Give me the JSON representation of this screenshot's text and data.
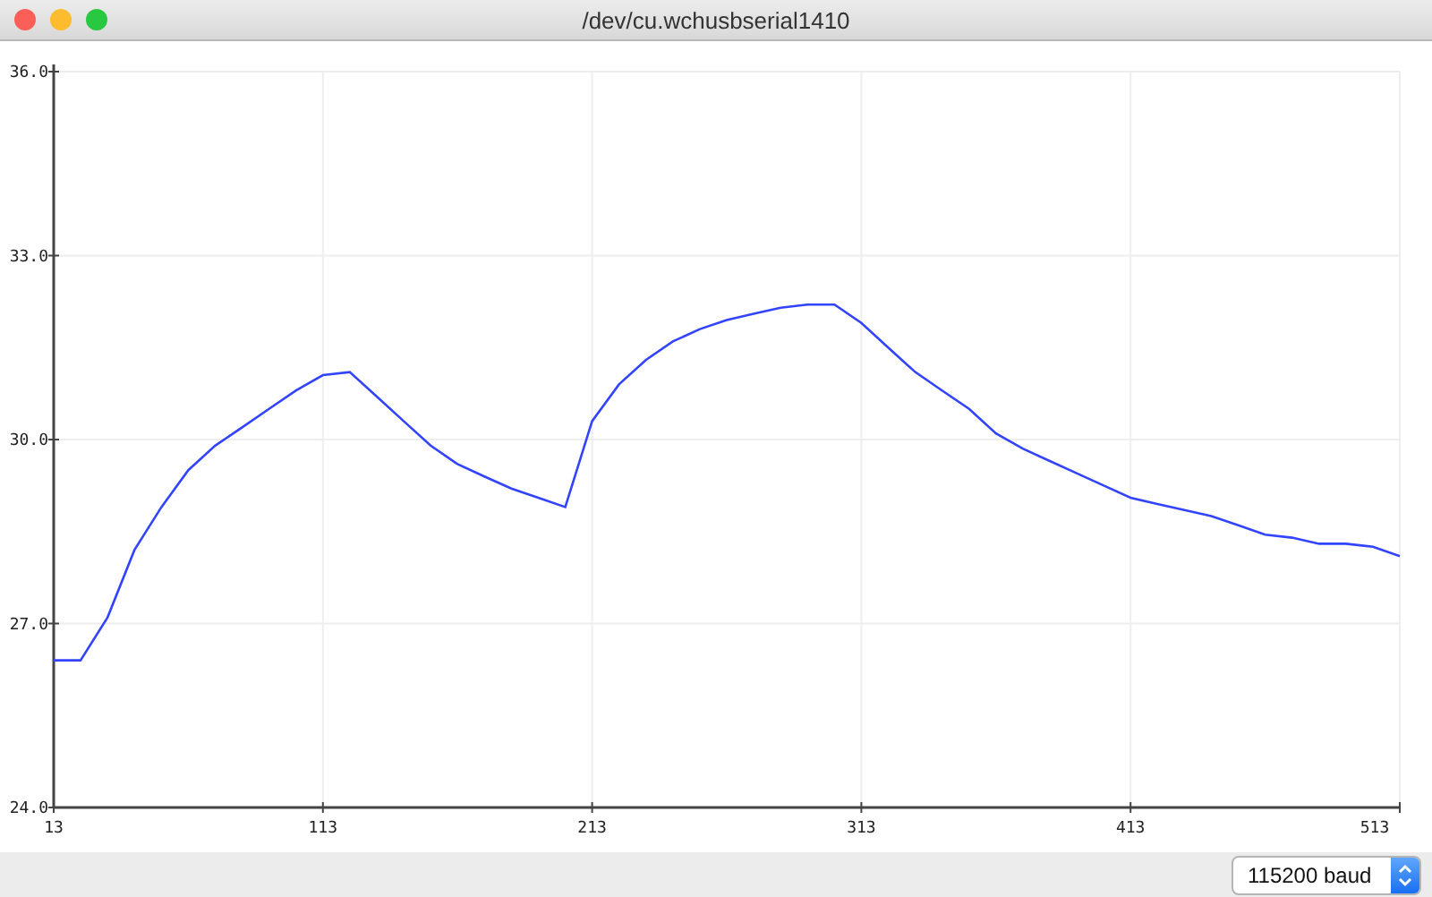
{
  "window": {
    "title": "/dev/cu.wchusbserial1410"
  },
  "plot": {
    "chart_data": {
      "type": "line",
      "x": [
        13,
        23,
        33,
        43,
        53,
        63,
        73,
        83,
        93,
        103,
        113,
        123,
        133,
        143,
        153,
        163,
        173,
        183,
        193,
        203,
        213,
        223,
        233,
        243,
        253,
        263,
        273,
        283,
        293,
        303,
        313,
        323,
        333,
        343,
        353,
        363,
        373,
        383,
        393,
        403,
        413,
        423,
        433,
        443,
        453,
        463,
        473,
        483,
        493,
        503,
        513
      ],
      "grid": true,
      "series": [
        {
          "color": "#3344ff",
          "values": [
            26.4,
            26.4,
            27.1,
            28.2,
            28.9,
            29.5,
            29.9,
            30.2,
            30.5,
            30.8,
            31.05,
            31.1,
            30.7,
            30.3,
            29.9,
            29.6,
            29.4,
            29.2,
            29.05,
            28.9,
            30.3,
            30.9,
            31.3,
            31.6,
            31.8,
            31.95,
            32.05,
            32.15,
            32.2,
            32.2,
            31.9,
            31.5,
            31.1,
            30.8,
            30.5,
            30.1,
            29.85,
            29.65,
            29.45,
            29.25,
            29.05,
            28.95,
            28.85,
            28.75,
            28.6,
            28.45,
            28.4,
            28.3,
            28.3,
            28.25,
            28.1
          ]
        }
      ],
      "xlim": [
        13,
        513
      ],
      "ylim": [
        24,
        36
      ],
      "xticks": [
        13,
        113,
        213,
        313,
        413,
        513
      ],
      "yticks": [
        {
          "value": 24,
          "label": "24.0"
        },
        {
          "value": 27,
          "label": "27.0"
        },
        {
          "value": 30,
          "label": "30.0"
        },
        {
          "value": 33,
          "label": "33.0"
        },
        {
          "value": 36,
          "label": "36.0"
        }
      ]
    }
  },
  "baud_select": {
    "value": "115200 baud"
  }
}
